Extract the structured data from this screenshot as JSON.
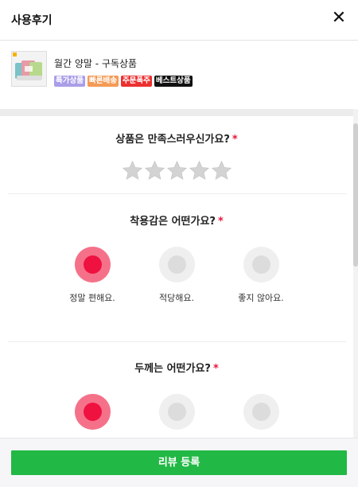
{
  "header": {
    "title": "사용후기",
    "close_label": "✕"
  },
  "product": {
    "name": "월간 양말 - 구독상품",
    "tags": [
      {
        "label": "특가상품",
        "color": "#a99ee8"
      },
      {
        "label": "빠른배송",
        "color": "#f49a55"
      },
      {
        "label": "주문폭주",
        "color": "#ec3030"
      },
      {
        "label": "베스트상품",
        "color": "#111111"
      }
    ]
  },
  "questions": {
    "satisfaction": {
      "label": "상품은 만족스러우신가요?",
      "required_mark": "*",
      "rating": 0,
      "max": 5
    },
    "fit": {
      "label": "착용감은 어떤가요?",
      "required_mark": "*",
      "options": [
        "정말 편해요.",
        "적당해요.",
        "좋지 않아요."
      ],
      "selected": 0
    },
    "thickness": {
      "label": "두께는 어떤가요?",
      "required_mark": "*",
      "selected": 0
    }
  },
  "footer": {
    "submit_label": "리뷰 등록"
  },
  "colors": {
    "accent": "#ef1140",
    "submit": "#22b845"
  }
}
